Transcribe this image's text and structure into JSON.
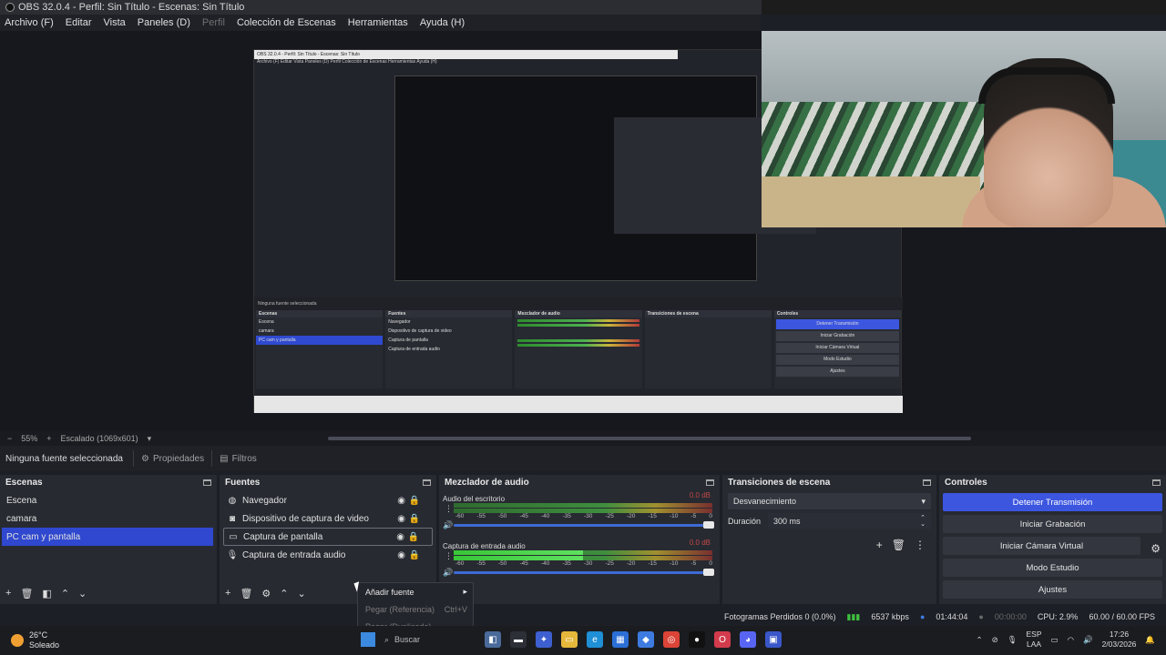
{
  "window": {
    "title": "OBS 32.0.4 - Perfil: Sin Título - Escenas: Sin Título"
  },
  "menu": [
    {
      "label": "Archivo (F)",
      "disabled": false
    },
    {
      "label": "Editar",
      "disabled": false
    },
    {
      "label": "Vista",
      "disabled": false
    },
    {
      "label": "Paneles (D)",
      "disabled": false
    },
    {
      "label": "Perfil",
      "disabled": true
    },
    {
      "label": "Colección de Escenas",
      "disabled": false
    },
    {
      "label": "Herramientas",
      "disabled": false
    },
    {
      "label": "Ayuda (H)",
      "disabled": false
    }
  ],
  "zoombar": {
    "zoom": "55%",
    "scale": "Escalado (1069x601)"
  },
  "propbar": {
    "no_source": "Ninguna fuente seleccionada",
    "properties": "Propiedades",
    "filters": "Filtros"
  },
  "scenes": {
    "title": "Escenas",
    "items": [
      "Escena",
      "camara",
      "PC  cam y pantalla"
    ],
    "selected_index": 2
  },
  "sources": {
    "title": "Fuentes",
    "items": [
      {
        "label": "Navegador",
        "icon": "globe-icon"
      },
      {
        "label": "Dispositivo de captura de video",
        "icon": "camera-icon"
      },
      {
        "label": "Captura de pantalla",
        "icon": "monitor-icon"
      },
      {
        "label": "Captura de entrada audio",
        "icon": "microphone-icon"
      }
    ]
  },
  "mixer": {
    "title": "Mezclador de audio",
    "channels": [
      {
        "name": "Audio del escritorio",
        "db": "0.0 dB",
        "level": 0.0
      },
      {
        "name": "Captura de entrada audio",
        "db": "0.0 dB",
        "level": 0.5
      }
    ],
    "ticks": [
      "-60",
      "-55",
      "-50",
      "-45",
      "-40",
      "-35",
      "-30",
      "-25",
      "-20",
      "-15",
      "-10",
      "-5",
      "0"
    ]
  },
  "transitions": {
    "title": "Transiciones de escena",
    "selected": "Desvanecimiento",
    "duration_label": "Duración",
    "duration_value": "300 ms"
  },
  "controls": {
    "title": "Controles",
    "stop_stream": "Detener Transmisión",
    "start_recording": "Iniciar Grabación",
    "start_virtual_cam": "Iniciar Cámara Virtual",
    "studio_mode": "Modo Estudio",
    "settings": "Ajustes"
  },
  "context_menu": {
    "add_source": "Añadir fuente",
    "paste_ref": "Pegar (Referencia)",
    "paste_ref_shortcut": "Ctrl+V",
    "paste_dup": "Pegar (Duplicado)"
  },
  "status": {
    "dropped": "Fotogramas Perdidos 0 (0.0%)",
    "kbps": "6537 kbps",
    "stream_time": "01:44:04",
    "rec_time": "00:00:00",
    "cpu": "CPU: 2.9%",
    "fps": "60.00 / 60.00 FPS"
  },
  "taskbar": {
    "temp": "26°C",
    "weather": "Soleado",
    "search": "Buscar",
    "lang1": "ESP",
    "lang2": "LAA",
    "time": "17:26",
    "date": "2/03/2026"
  },
  "nested_preview": {
    "title": "OBS 32.0.4 - Perfil: Sin Título - Escenas: Sin Título",
    "menu": "Archivo (F)   Editar   Vista   Paneles (D)   Perfil   Colección de Escenas   Herramientas   Ayuda (H)",
    "no_source": "Ninguna fuente seleccionada",
    "scenes": "Escenas",
    "sources": "Fuentes",
    "mixer": "Mezclador de audio",
    "transitions": "Transiciones de escena",
    "controls": "Controles",
    "scene_items": [
      "Escena",
      "camara",
      "PC  cam y pantalla"
    ],
    "source_items": [
      "Navegador",
      "Dispositivo de captura de video",
      "Captura de pantalla",
      "Captura de entrada audio"
    ],
    "control_items": [
      "Detener Transmisión",
      "Iniciar Grabación",
      "Iniciar Cámara Virtual",
      "Modo Estudio",
      "Ajustes"
    ]
  }
}
